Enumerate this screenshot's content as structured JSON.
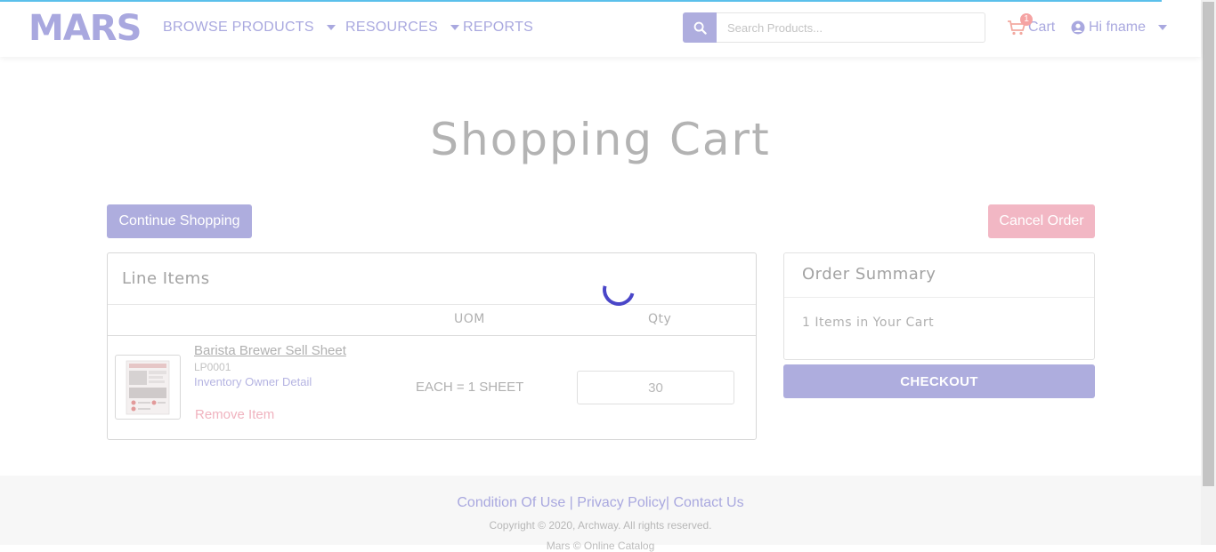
{
  "header": {
    "logo": "MARS",
    "nav": {
      "browse": "BROWSE PRODUCTS",
      "resources": "RESOURCES",
      "reports": "REPORTS"
    },
    "search": {
      "placeholder": "Search Products..."
    },
    "cart": {
      "label": "Cart",
      "count": "1"
    },
    "user": {
      "greeting": "Hi fname"
    }
  },
  "page": {
    "title": "Shopping Cart",
    "continue_label": "Continue Shopping",
    "cancel_label": "Cancel Order"
  },
  "line_items": {
    "title": "Line Items",
    "columns": {
      "uom": "UOM",
      "qty": "Qty"
    },
    "items": [
      {
        "name": "Barista Brewer Sell Sheet",
        "sku": "LP0001",
        "owner": "Inventory Owner Detail",
        "remove_label": "Remove Item",
        "uom": "EACH = 1 SHEET",
        "qty": "30"
      }
    ]
  },
  "summary": {
    "title": "Order Summary",
    "count_text": "1 Items in Your Cart",
    "checkout_label": "CHECKOUT"
  },
  "footer": {
    "links": [
      "Condition Of Use",
      "Privacy Policy",
      "Contact Us"
    ],
    "separator": "|",
    "copyright": "Copyright © 2020, Archway. All rights reserved.",
    "sub": "Mars © Online Catalog"
  },
  "colors": {
    "brand": "#a9a8df",
    "button_primary": "#aeadde",
    "button_danger": "#f2b7c4",
    "spinner": "#4a46c8",
    "cart_badge": "#f5a3a3"
  }
}
